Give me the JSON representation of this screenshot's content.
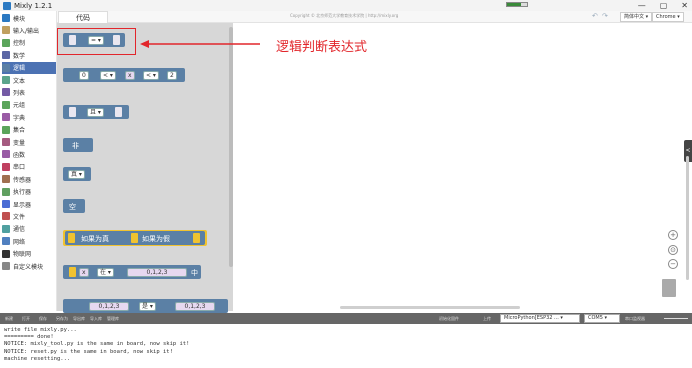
{
  "window": {
    "title": "Mixly 1.2.1",
    "min": "—",
    "max": "▢",
    "close": "✕",
    "progress": 0.7
  },
  "toolbar": {
    "tab_code": "代码",
    "copyright": "Copyright © 北京师范大学教育技术学院 | http://mixly.org",
    "undo": "↶",
    "redo": "↷",
    "language": "简体中文 ▾",
    "browser": "Chrome ▾"
  },
  "sidebar": {
    "items": [
      {
        "label": "模块",
        "color": "#2b79c2"
      },
      {
        "label": "输入/输出",
        "color": "#c0a060"
      },
      {
        "label": "控制",
        "color": "#5ba55b"
      },
      {
        "label": "数学",
        "color": "#5b67a5"
      },
      {
        "label": "逻辑",
        "color": "#5b80a5"
      },
      {
        "label": "文本",
        "color": "#5ba58c"
      },
      {
        "label": "列表",
        "color": "#745ba5"
      },
      {
        "label": "元组",
        "color": "#5ba55b"
      },
      {
        "label": "字典",
        "color": "#9a5ba5"
      },
      {
        "label": "集合",
        "color": "#5ba55b"
      },
      {
        "label": "变量",
        "color": "#a55b80"
      },
      {
        "label": "函数",
        "color": "#995ba5"
      },
      {
        "label": "串口",
        "color": "#c04060"
      },
      {
        "label": "传感器",
        "color": "#a07050"
      },
      {
        "label": "执行器",
        "color": "#60a060"
      },
      {
        "label": "显示器",
        "color": "#4a6cd4"
      },
      {
        "label": "文件",
        "color": "#c05050"
      },
      {
        "label": "通信",
        "color": "#50a0a0"
      },
      {
        "label": "网络",
        "color": "#5080c0"
      },
      {
        "label": "物联网",
        "color": "#333333"
      },
      {
        "label": "自定义模块",
        "color": "#888888"
      }
    ]
  },
  "blocks": {
    "eq_op": "= ▾",
    "cmp_a": "0",
    "cmp_op1": "< ▾",
    "cmp_x": "x",
    "cmp_op2": "< ▾",
    "cmp_b": "2",
    "and_op": "且 ▾",
    "not_label": "非",
    "bool_val": "真 ▾",
    "none_label": "空",
    "ternary_true": "如果为真",
    "ternary_false": "如果为假",
    "in_var": "x",
    "in_op": "在 ▾",
    "in_list": "0,1,2,3",
    "in_suffix": "中",
    "list_a": "0,1,2,3",
    "list_op": "是 ▾",
    "list_b": "0,1,2,3"
  },
  "annotation": {
    "text": "逻辑判断表达式"
  },
  "workspace": {
    "zoom_in": "+",
    "reset": "⊙",
    "zoom_out": "−",
    "collapse": "<"
  },
  "bottombar": {
    "buttons": [
      "新建",
      "打开",
      "保存",
      "另存为",
      "导出库",
      "导入库",
      "管理库"
    ],
    "right_buttons": [
      "初始化固件",
      "上传"
    ],
    "board": "MicroPython[ESP32 ... ▾",
    "port": "COM5 ▾",
    "serial": "串口监视器"
  },
  "console": {
    "lines": [
      "write file mixly.py...",
      "========= done!",
      "NOTICE: mixly_tool.py is the same in board, now skip it!",
      "NOTICE: reset.py is the same in board, now skip it!",
      "machine resetting..."
    ]
  }
}
